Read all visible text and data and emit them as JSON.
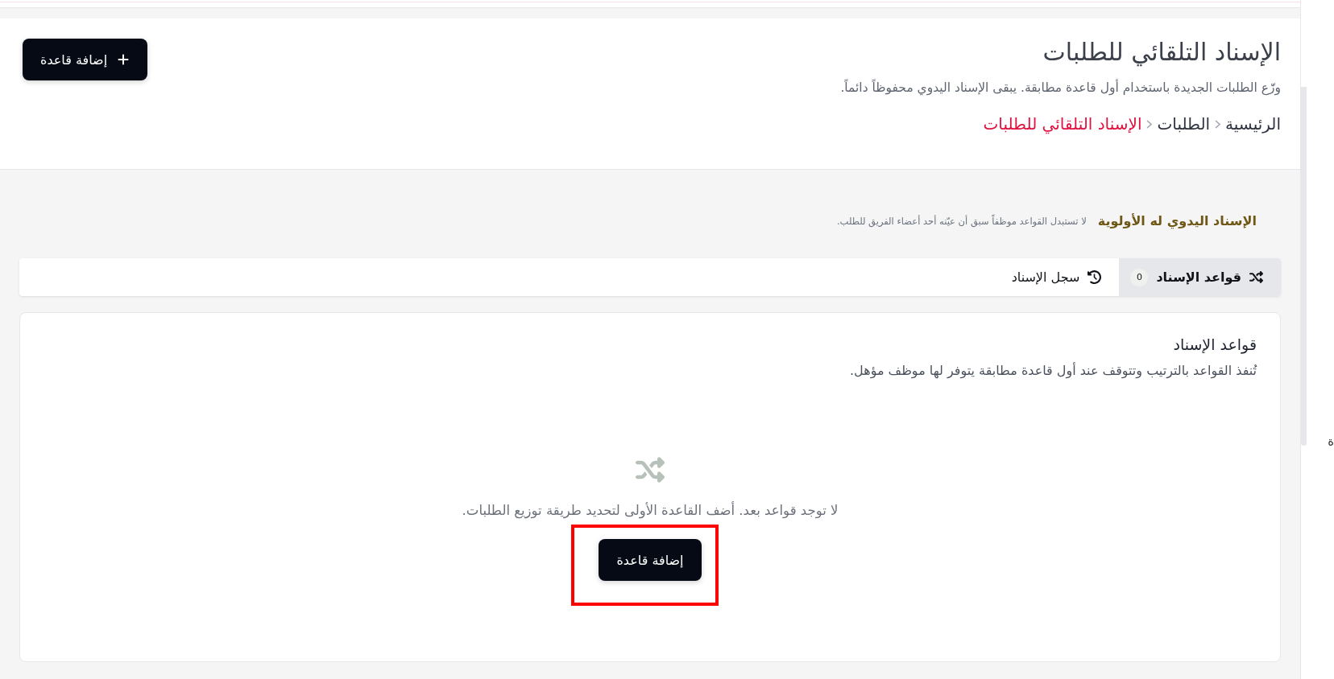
{
  "header": {
    "title": "الإسناد التلقائي للطلبات",
    "subtitle": "وزّع الطلبات الجديدة باستخدام أول قاعدة مطابقة. يبقى الإسناد اليدوي محفوظاً دائماً.",
    "add_button": {
      "label": "إضافة قاعدة"
    }
  },
  "breadcrumb": [
    {
      "label": "الرئيسية",
      "current": false
    },
    {
      "label": "الطلبات",
      "current": false
    },
    {
      "label": "الإسناد التلقائي للطلبات",
      "current": true
    }
  ],
  "notice": {
    "title": "الإسناد اليدوي له الأولوية",
    "text": "لا تستبدل القواعد موظفاً سبق أن عيّنه أحد أعضاء الفريق للطلب."
  },
  "tabs": [
    {
      "kind": "rules",
      "label": "قواعد الإسناد",
      "count": "0",
      "selected": true
    },
    {
      "kind": "history",
      "label": "سجل الإسناد",
      "selected": false
    }
  ],
  "rules_card": {
    "title": "قواعد الإسناد",
    "description": "تُنفذ القواعد بالترتيب وتتوقف عند أول قاعدة مطابقة يتوفر لها موظف مؤهل.",
    "empty_state": {
      "message": "لا توجد قواعد بعد. أضف القاعدة الأولى لتحديد طريقة توزيع الطلبات.",
      "button": {
        "label": "إضافة قاعدة",
        "highlighted": true
      }
    }
  },
  "edge_text": "ة"
}
